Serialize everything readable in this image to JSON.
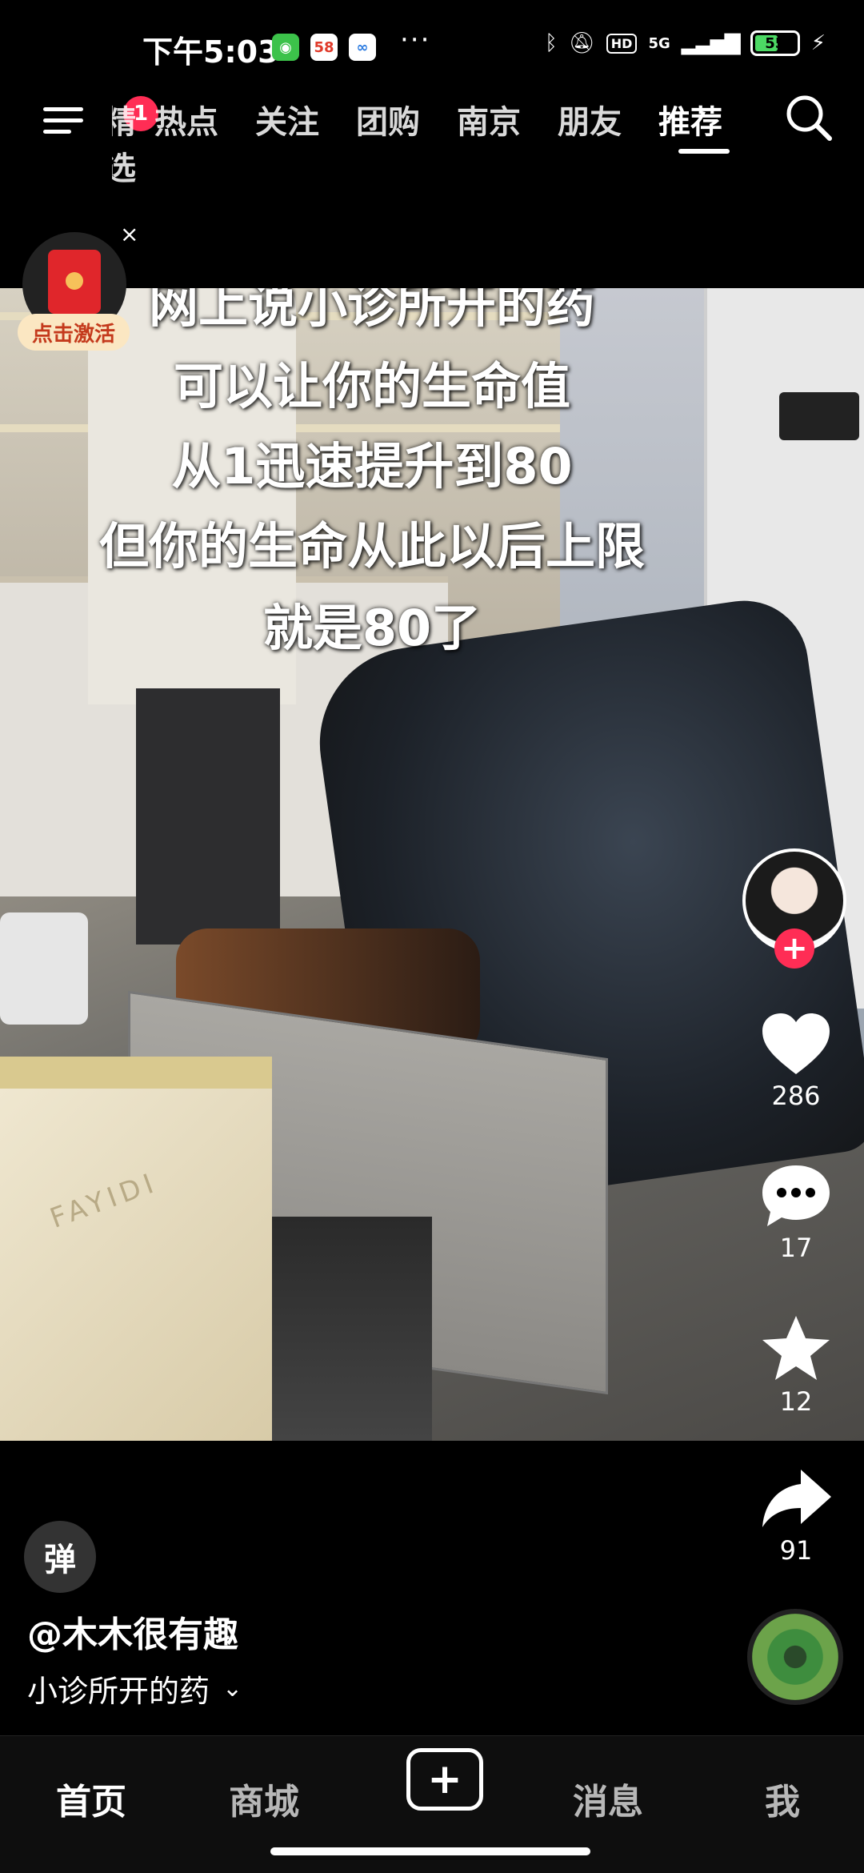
{
  "status_bar": {
    "time": "下午5:03",
    "app_icons": [
      "wechat-icon",
      "58-app-icon",
      "baidu-netdisk-icon"
    ],
    "more": "···",
    "network": "5G",
    "hd": "HD",
    "battery": "55",
    "battery_level": 0.55
  },
  "top_nav": {
    "badge": "1",
    "tabs": [
      "精选",
      "热点",
      "关注",
      "团购",
      "南京",
      "朋友",
      "推荐"
    ],
    "active_tab": "推荐"
  },
  "red_packet": {
    "label": "点击激活",
    "close": "×"
  },
  "video": {
    "captions": [
      "网上说小诊所开的药",
      "可以让你的生命值",
      "从1迅速提升到80",
      "但你的生命从此以后上限",
      "就是80了"
    ],
    "box_brand": "FAYIDI"
  },
  "actions": {
    "follow": "+",
    "likes": "286",
    "comments": "17",
    "favorites": "12",
    "shares": "91"
  },
  "post": {
    "danmu": "弹",
    "author": "@木木很有趣",
    "description": "小诊所开的药"
  },
  "tab_bar": {
    "home": "首页",
    "mall": "商城",
    "create": "+",
    "messages": "消息",
    "me": "我"
  },
  "colors": {
    "accent_red": "#ff2d55",
    "battery_green": "#4cd964",
    "background": "#000000"
  }
}
